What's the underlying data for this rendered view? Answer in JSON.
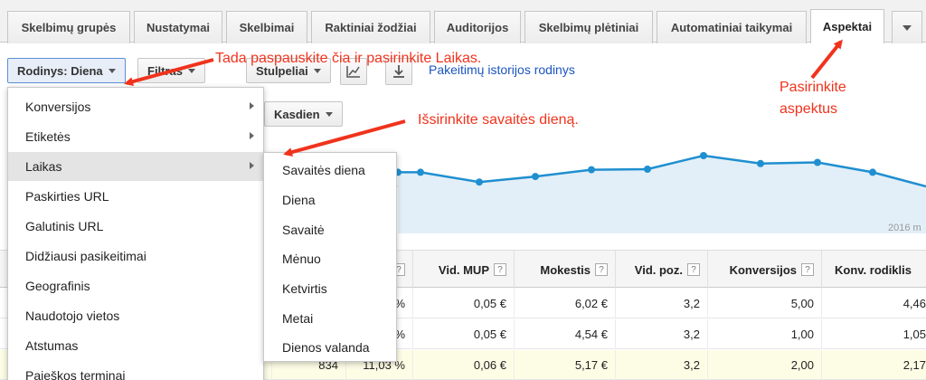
{
  "tabs": [
    {
      "label": "Skelbimų grupės"
    },
    {
      "label": "Nustatymai"
    },
    {
      "label": "Skelbimai"
    },
    {
      "label": "Raktiniai žodžiai"
    },
    {
      "label": "Auditorijos"
    },
    {
      "label": "Skelbimų plėtiniai"
    },
    {
      "label": "Automatiniai taikymai"
    },
    {
      "label": "Aspektai"
    }
  ],
  "toolbar": {
    "view_label": "Rodinys: Diena",
    "filter_label": "Filtras",
    "columns_label": "Stulpeliai",
    "change_history_link": "Pakeitimų istorijos rodinys",
    "daily_label": "Kasdien"
  },
  "menu": {
    "items": [
      {
        "label": "Konversijos",
        "submenu": true
      },
      {
        "label": "Etiketės",
        "submenu": true
      },
      {
        "label": "Laikas",
        "submenu": true
      },
      {
        "label": "Paskirties URL",
        "submenu": false
      },
      {
        "label": "Galutinis URL",
        "submenu": false
      },
      {
        "label": "Didžiausi pasikeitimai",
        "submenu": false
      },
      {
        "label": "Geografinis",
        "submenu": false
      },
      {
        "label": "Naudotojo vietos",
        "submenu": false
      },
      {
        "label": "Atstumas",
        "submenu": false
      },
      {
        "label": "Paieškos terminai",
        "submenu": false
      }
    ],
    "hovered_index": 2
  },
  "submenu": {
    "items": [
      "Savaitės diena",
      "Diena",
      "Savaitė",
      "Mėnuo",
      "Ketvirtis",
      "Metai",
      "Dienos valanda"
    ]
  },
  "chart": {
    "year_label": "2016 m",
    "line_color": "#1f8fd0",
    "fill_color": "#e3eff8",
    "values": [
      0.73,
      0.73,
      0.57,
      0.66,
      0.77,
      0.78,
      1.0,
      0.87,
      0.89,
      0.73,
      0.5
    ]
  },
  "table": {
    "headers": [
      "Vid. MUP",
      "Mokestis",
      "Vid. poz.",
      "Konversijos",
      "Konv. rodiklis"
    ],
    "rows": [
      {
        "partial_pct": "%",
        "cells": [
          "0,05 €",
          "6,02 €",
          "3,2",
          "5,00",
          "4,46"
        ],
        "highlight": false
      },
      {
        "partial_pct": "%",
        "cells": [
          "0,05 €",
          "4,54 €",
          "3,2",
          "1,00",
          "1,05"
        ],
        "highlight": false
      },
      {
        "partial_num": "834",
        "partial_pct": "11,03 %",
        "cells": [
          "0,06 €",
          "5,17 €",
          "3,2",
          "2,00",
          "2,17"
        ],
        "highlight": true
      }
    ]
  },
  "annotations": {
    "top": "Tada paspauskite čia ir pasirinkite Laikas.",
    "middle": "Išsirinkite savaitės dieną.",
    "right_line1": "Pasirinkite",
    "right_line2": "aspektus",
    "color": "#f0331c"
  }
}
